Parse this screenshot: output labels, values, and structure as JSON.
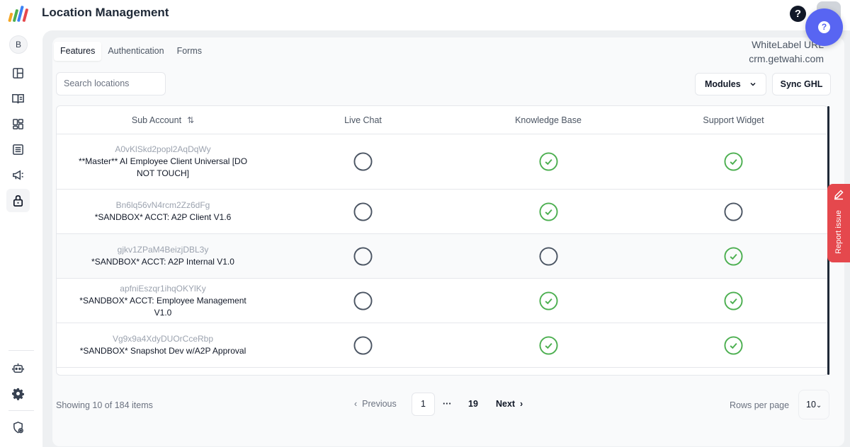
{
  "header": {
    "title": "Location Management"
  },
  "sidebar": {
    "avatar_letter": "B"
  },
  "tabs": [
    {
      "label": "Features",
      "active": true
    },
    {
      "label": "Authentication",
      "active": false
    },
    {
      "label": "Forms",
      "active": false
    }
  ],
  "whitelabel": {
    "label": "WhiteLabel URL",
    "value": "crm.getwahi.com"
  },
  "search": {
    "placeholder": "Search locations"
  },
  "toolbar": {
    "modules_label": "Modules",
    "sync_label": "Sync GHL"
  },
  "table": {
    "columns": [
      "Sub Account",
      "Live Chat",
      "Knowledge Base",
      "Support Widget"
    ],
    "rows": [
      {
        "id": "A0vKlSkd2popl2AqDqWy",
        "name": "**Master** AI Employee Client Universal [DO NOT TOUCH]",
        "live_chat": false,
        "knowledge_base": true,
        "support_widget": true
      },
      {
        "id": "Bn6lq56vN4rcm2Zz6dFg",
        "name": "*SANDBOX* ACCT: A2P Client V1.6",
        "live_chat": false,
        "knowledge_base": true,
        "support_widget": false
      },
      {
        "id": "gjkv1ZPaM4BeizjDBL3y",
        "name": "*SANDBOX* ACCT: A2P Internal V1.0",
        "live_chat": false,
        "knowledge_base": false,
        "support_widget": true
      },
      {
        "id": "apfniEszqr1ihqOKYlKy",
        "name": "*SANDBOX* ACCT: Employee Management V1.0",
        "live_chat": false,
        "knowledge_base": true,
        "support_widget": true
      },
      {
        "id": "Vg9x9a4XdyDUOrCceRbp",
        "name": "*SANDBOX* Snapshot Dev w/A2P Approval",
        "live_chat": false,
        "knowledge_base": true,
        "support_widget": true
      }
    ]
  },
  "pagination": {
    "showing": "Showing 10 of 184 items",
    "previous": "Previous",
    "current": "1",
    "ellipsis": "···",
    "last": "19",
    "next": "Next",
    "rows_per_page_label": "Rows per page",
    "rows_per_page": "10"
  },
  "report_issue": {
    "label": "Report issue"
  },
  "colors": {
    "accent": "#5865f2",
    "check_green": "#4caf50",
    "report_red": "#e5484d"
  }
}
